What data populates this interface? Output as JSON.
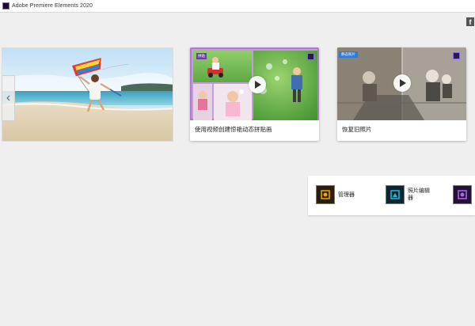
{
  "window": {
    "title": "Adobe Premiere Elements 2020"
  },
  "cards": [
    {
      "caption": "使用视频创建惊艳动态拼贴画",
      "badge": "",
      "play_icon": "play-icon"
    },
    {
      "caption": "恢复旧照片",
      "badge": "静态照片",
      "play_icon": "play-icon"
    }
  ],
  "launcher": {
    "items": [
      {
        "label": "管理器",
        "icon": "organizer-icon",
        "color": "#f0a500"
      },
      {
        "label": "照片编辑器",
        "icon": "photo-editor-icon",
        "color": "#2ab6d6"
      },
      {
        "label": "",
        "icon": "video-editor-icon",
        "color": "#b06ae8"
      }
    ]
  },
  "colors": {
    "accent_purple": "#8a5cff",
    "collage_border": "#b07ad1",
    "badge_blue": "#2f7bd9"
  }
}
